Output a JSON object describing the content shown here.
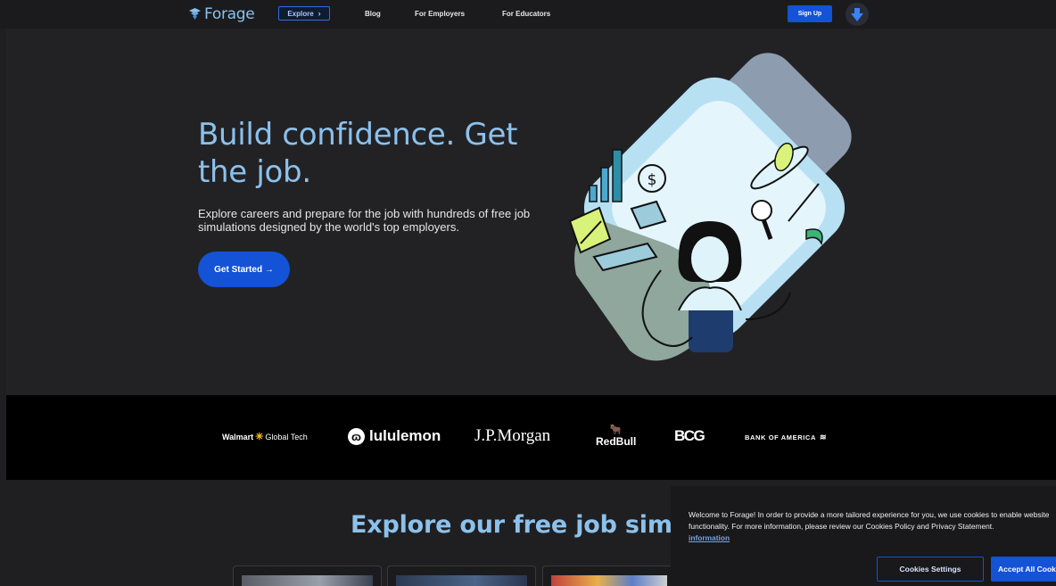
{
  "nav": {
    "logo_text": "Forage",
    "explore_label": "Explore",
    "links": [
      "Blog",
      "For Employers",
      "For Educators"
    ],
    "signup_label": "Sign Up"
  },
  "hero": {
    "title": "Build confidence. Get the job.",
    "subtitle": "Explore careers and prepare for the job with hundreds of free job simulations designed by the world's top employers.",
    "cta_label": "Get Started →"
  },
  "brands": {
    "walmart": "Walmart",
    "walmart_suffix": "Global Tech",
    "lululemon": "lululemon",
    "jpmorgan": "J.P.Morgan",
    "redbull": "RedBull",
    "bcg": "BCG",
    "boa": "BANK OF AMERICA"
  },
  "explore": {
    "title": "Explore our free job simulations"
  },
  "cookie": {
    "text": "Welcome to Forage! In order to provide a more tailored experience for you, we use cookies to enable website functionality. For more information, please review our Cookies Policy and Privacy Statement.",
    "link_label": "information",
    "settings_label": "Cookies Settings",
    "accept_label": "Accept All Cookies"
  },
  "colors": {
    "accent_blue": "#1452d6",
    "title_blue": "#8cc1ec",
    "background": "#1f1f21"
  }
}
